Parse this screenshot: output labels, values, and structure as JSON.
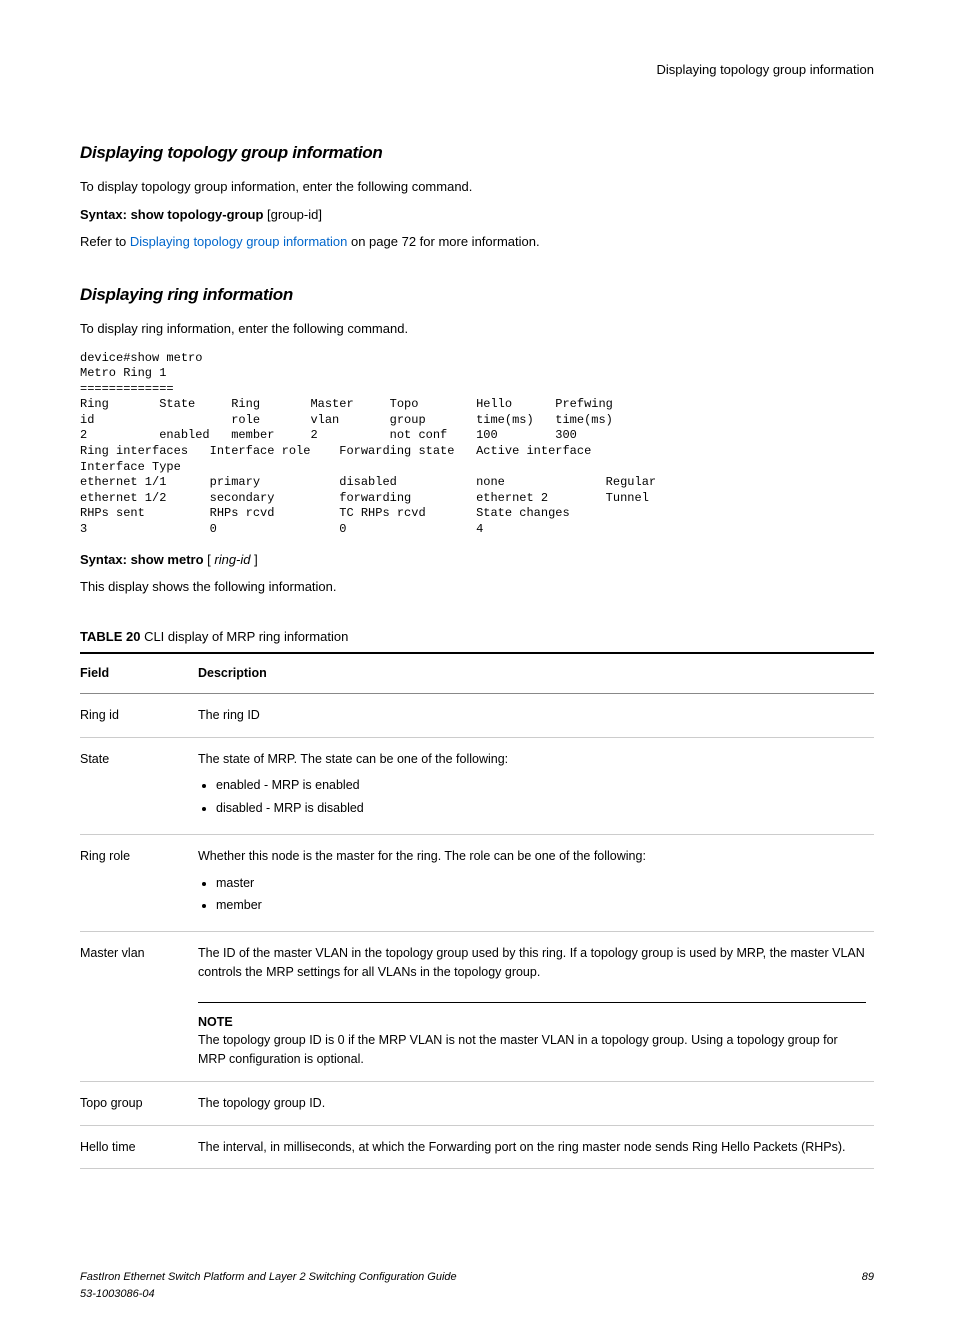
{
  "header": {
    "right": "Displaying topology group information"
  },
  "section1": {
    "title": "Displaying topology group information",
    "intro": "To display topology group information, enter the following command.",
    "syntax_label": "Syntax: show topology-group",
    "syntax_arg": " [group-id]",
    "refer_prefix": "Refer to ",
    "refer_link": "Displaying topology group information",
    "refer_suffix": " on page 72 for more information."
  },
  "section2": {
    "title": "Displaying ring information",
    "intro": "To display ring information, enter the following command.",
    "code": "device#show metro\nMetro Ring 1\n=============\nRing       State     Ring       Master     Topo        Hello      Prefwing\nid                   role       vlan       group       time(ms)   time(ms)\n2          enabled   member     2          not conf    100        300\nRing interfaces   Interface role    Forwarding state   Active interface  \nInterface Type\nethernet 1/1      primary           disabled           none              Regular\nethernet 1/2      secondary         forwarding         ethernet 2        Tunnel\nRHPs sent         RHPs rcvd         TC RHPs rcvd       State changes\n3                 0                 0                  4",
    "syntax_label": "Syntax: show metro",
    "syntax_arg_open": " [ ",
    "syntax_arg_italic": "ring-id",
    "syntax_arg_close": " ]",
    "desc": "This display shows the following information."
  },
  "table": {
    "caption_label": "TABLE 20 ",
    "caption_text": "  CLI display of MRP ring information",
    "headers": {
      "field": "Field",
      "description": "Description"
    },
    "rows": {
      "r1": {
        "field": "Ring id",
        "desc": "The ring ID"
      },
      "r2": {
        "field": "State",
        "desc": "The state of MRP. The state can be one of the following:",
        "b1": "enabled - MRP is enabled",
        "b2": "disabled - MRP is disabled"
      },
      "r3": {
        "field": "Ring role",
        "desc": "Whether this node is the master for the ring. The role can be one of the following:",
        "b1": "master",
        "b2": "member"
      },
      "r4": {
        "field": "Master vlan",
        "desc": "The ID of the master VLAN in the topology group used by this ring. If a topology group is used by MRP, the master VLAN controls the MRP settings for all VLANs in the topology group.",
        "note_label": "NOTE",
        "note_text": "The topology group ID is 0 if the MRP VLAN is not the master VLAN in a topology group. Using a topology group for MRP configuration is optional."
      },
      "r5": {
        "field": "Topo group",
        "desc": "The topology group ID."
      },
      "r6": {
        "field": "Hello time",
        "desc": "The interval, in milliseconds, at which the Forwarding port on the ring master node sends Ring Hello Packets (RHPs)."
      }
    }
  },
  "footer": {
    "left1": "FastIron Ethernet Switch Platform and Layer 2 Switching Configuration Guide",
    "left2": "53-1003086-04",
    "page": "89"
  }
}
